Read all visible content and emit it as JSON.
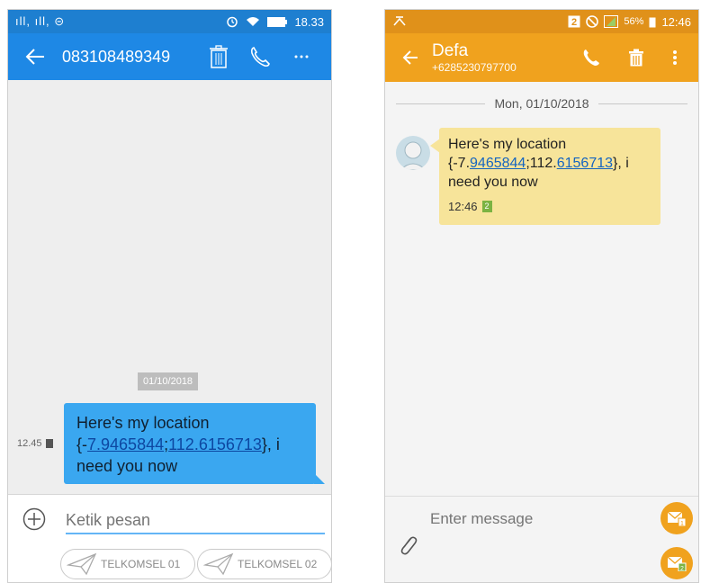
{
  "left": {
    "status": {
      "signal": "ıll, ıll, ⊝",
      "time": "18.33"
    },
    "header": {
      "title": "083108489349"
    },
    "date_chip": "01/10/2018",
    "message": {
      "time": "12.45",
      "text_before": "Here's my location {-",
      "link1": "7.9465844",
      "sep": ";",
      "link2": "112.6156713",
      "text_after": "}, i need you now"
    },
    "composer": {
      "placeholder": "Ketik pesan",
      "sim1": "TELKOMSEL 01",
      "sim2": "TELKOMSEL 02"
    },
    "accent": "#1e88e5"
  },
  "right": {
    "status": {
      "battery": "56%",
      "time": "12:46"
    },
    "header": {
      "name": "Defa",
      "number": "+6285230797700"
    },
    "date_divider": "Mon, 01/10/2018",
    "message": {
      "text_before": "Here's my location {-7.",
      "link1": "9465844",
      "sep": ";112.",
      "link2": "6156713",
      "text_after": "}, i need you now",
      "time": "12:46",
      "sim": "2"
    },
    "composer": {
      "placeholder": "Enter message"
    },
    "accent": "#f0a21e"
  }
}
